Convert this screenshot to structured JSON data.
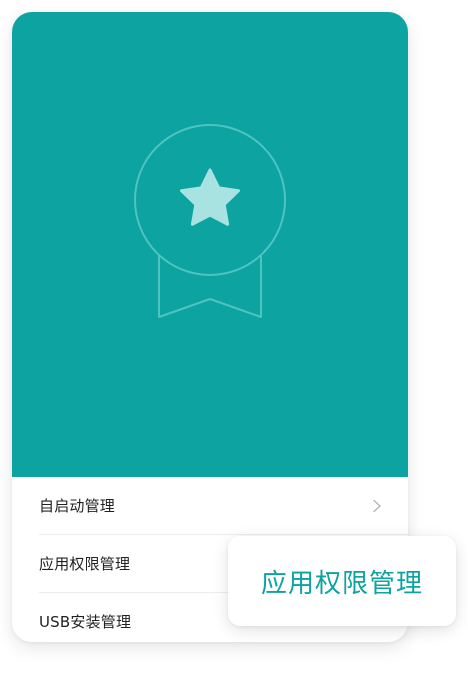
{
  "colors": {
    "accent": "#0ca3a0",
    "badge_outline": "#4ec4c1",
    "star_fill": "#a8e3e1",
    "text_primary": "#222222",
    "chevron": "#b5b5b5"
  },
  "hero": {
    "icon": "award-ribbon-star-icon"
  },
  "menu": {
    "items": [
      {
        "label": "自启动管理",
        "icon": "chevron-right-icon"
      },
      {
        "label": "应用权限管理"
      },
      {
        "label": "USB安装管理"
      }
    ]
  },
  "tooltip": {
    "text": "应用权限管理"
  }
}
